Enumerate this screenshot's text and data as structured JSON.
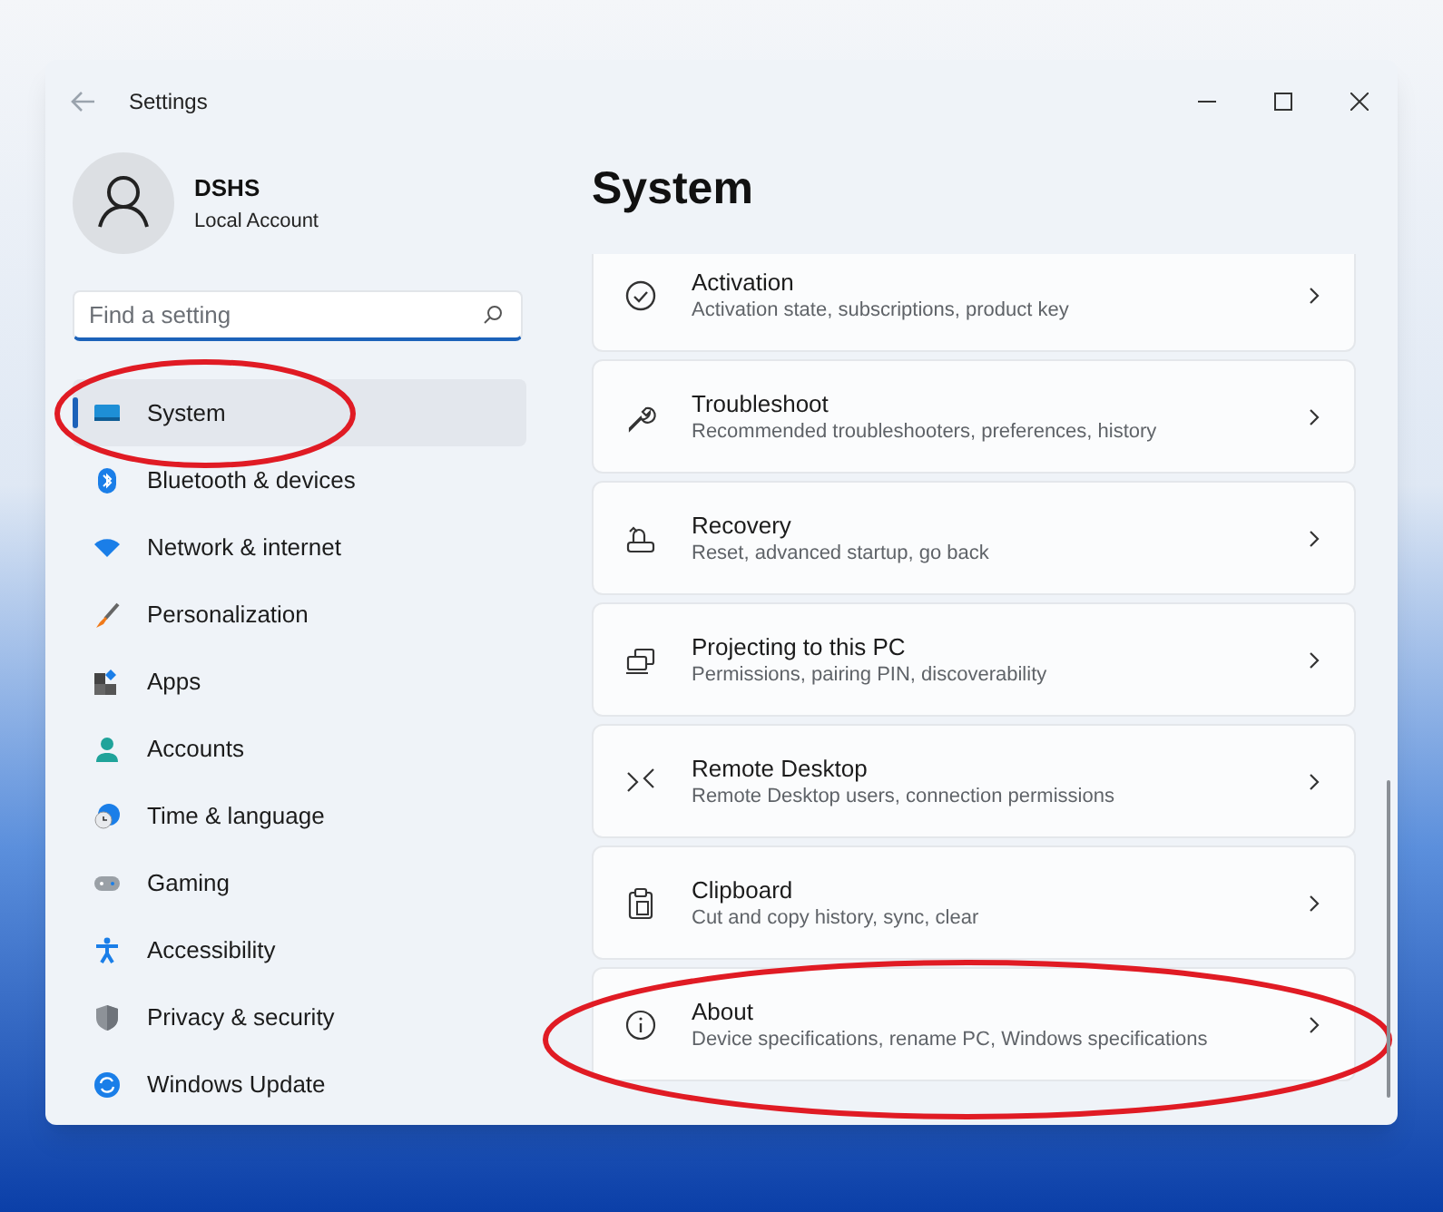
{
  "window": {
    "title": "Settings"
  },
  "account": {
    "name": "DSHS",
    "type": "Local Account"
  },
  "search": {
    "placeholder": "Find a setting"
  },
  "nav": [
    {
      "label": "System",
      "selected": true,
      "circled": true
    },
    {
      "label": "Bluetooth & devices",
      "selected": false,
      "circled": false
    },
    {
      "label": "Network & internet",
      "selected": false,
      "circled": false
    },
    {
      "label": "Personalization",
      "selected": false,
      "circled": false
    },
    {
      "label": "Apps",
      "selected": false,
      "circled": false
    },
    {
      "label": "Accounts",
      "selected": false,
      "circled": false
    },
    {
      "label": "Time & language",
      "selected": false,
      "circled": false
    },
    {
      "label": "Gaming",
      "selected": false,
      "circled": false
    },
    {
      "label": "Accessibility",
      "selected": false,
      "circled": false
    },
    {
      "label": "Privacy & security",
      "selected": false,
      "circled": false
    },
    {
      "label": "Windows Update",
      "selected": false,
      "circled": false
    }
  ],
  "page_title": "System",
  "cards": [
    {
      "title": "Activation",
      "subtitle": "Activation state, subscriptions, product key",
      "circled": false
    },
    {
      "title": "Troubleshoot",
      "subtitle": "Recommended troubleshooters, preferences, history",
      "circled": false
    },
    {
      "title": "Recovery",
      "subtitle": "Reset, advanced startup, go back",
      "circled": false
    },
    {
      "title": "Projecting to this PC",
      "subtitle": "Permissions, pairing PIN, discoverability",
      "circled": false
    },
    {
      "title": "Remote Desktop",
      "subtitle": "Remote Desktop users, connection permissions",
      "circled": false
    },
    {
      "title": "Clipboard",
      "subtitle": "Cut and copy history, sync, clear",
      "circled": false
    },
    {
      "title": "About",
      "subtitle": "Device specifications, rename PC, Windows specifications",
      "circled": true
    }
  ]
}
